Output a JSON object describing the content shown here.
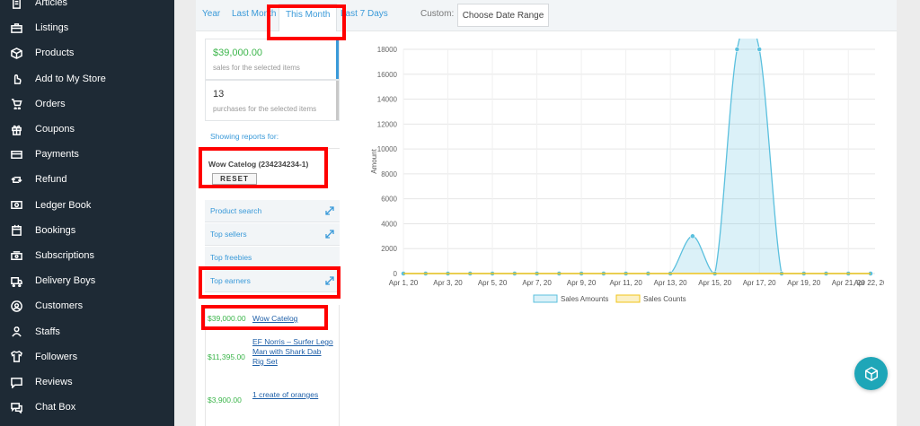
{
  "sidebar": {
    "items": [
      {
        "label": "Articles",
        "icon": "document-icon"
      },
      {
        "label": "Listings",
        "icon": "briefcase-icon"
      },
      {
        "label": "Products",
        "icon": "box-icon"
      },
      {
        "label": "Add to My Store",
        "icon": "hand-pointer-icon"
      },
      {
        "label": "Orders",
        "icon": "cart-icon"
      },
      {
        "label": "Coupons",
        "icon": "gift-icon"
      },
      {
        "label": "Payments",
        "icon": "credit-card-icon"
      },
      {
        "label": "Refund",
        "icon": "retweet-icon"
      },
      {
        "label": "Ledger Book",
        "icon": "money-icon"
      },
      {
        "label": "Bookings",
        "icon": "calendar-icon"
      },
      {
        "label": "Subscriptions",
        "icon": "cash-icon"
      },
      {
        "label": "Delivery Boys",
        "icon": "truck-icon"
      },
      {
        "label": "Customers",
        "icon": "user-circle-icon"
      },
      {
        "label": "Staffs",
        "icon": "user-icon"
      },
      {
        "label": "Followers",
        "icon": "shirt-icon"
      },
      {
        "label": "Reviews",
        "icon": "comment-icon"
      },
      {
        "label": "Chat Box",
        "icon": "chat-icon"
      }
    ]
  },
  "tabs": {
    "year": "Year",
    "last_month": "Last Month",
    "this_month": "This Month",
    "last_7_days": "Last 7 Days",
    "custom_label": "Custom:",
    "date_range_button": "Choose Date Range"
  },
  "stats": {
    "sales_value": "$39,000.00",
    "sales_desc": "sales for the selected items",
    "purchases_value": "13",
    "purchases_desc": "purchases for the selected items"
  },
  "filter": {
    "showing_label": "Showing reports for:",
    "catalog_name": "Wow Catelog (234234234-1)",
    "reset_label": "RESET"
  },
  "sections": {
    "product_search": "Product search",
    "top_sellers": "Top sellers",
    "top_freebies": "Top freebies",
    "top_earners": "Top earners"
  },
  "earners": [
    {
      "amount": "$39,000.00",
      "name": "Wow Catelog"
    },
    {
      "amount": "$11,395.00",
      "name": "EF Norris – Surfer Lego Man with Shark Dab Rig Set"
    },
    {
      "amount": "$3,900.00",
      "name": "1 create of oranges"
    }
  ],
  "colors": {
    "sidebar_bg": "#1e2a35",
    "accent": "#3a9ad9",
    "sales_series": "#5bc0de",
    "count_series": "#f0c419",
    "money_green": "#3bb54a",
    "highlight": "#ff0000",
    "fab": "#1ea6b8"
  },
  "chart_data": {
    "type": "area",
    "title": "",
    "xlabel": "",
    "ylabel": "Amount",
    "ylim": [
      0,
      18000
    ],
    "yticks": [
      0,
      2000,
      4000,
      6000,
      8000,
      10000,
      12000,
      14000,
      16000,
      18000
    ],
    "x": [
      "Apr 1, 20",
      "Apr 2, 20",
      "Apr 3, 20",
      "Apr 4, 20",
      "Apr 5, 20",
      "Apr 6, 20",
      "Apr 7, 20",
      "Apr 8, 20",
      "Apr 9, 20",
      "Apr 10, 20",
      "Apr 11, 20",
      "Apr 12, 20",
      "Apr 13, 20",
      "Apr 14, 20",
      "Apr 15, 20",
      "Apr 16, 20",
      "Apr 17, 20",
      "Apr 18, 20",
      "Apr 19, 20",
      "Apr 20, 20",
      "Apr 21, 20",
      "Apr 22, 20"
    ],
    "xtick_labels": [
      "Apr 1, 20",
      "Apr 3, 20",
      "Apr 5, 20",
      "Apr 7, 20",
      "Apr 9, 20",
      "Apr 11, 20",
      "Apr 13, 20",
      "Apr 15, 20",
      "Apr 17, 20",
      "Apr 19, 20",
      "Apr 21, 20",
      "Apr 22, 20"
    ],
    "series": [
      {
        "name": "Sales Amounts",
        "values": [
          0,
          0,
          0,
          0,
          0,
          0,
          0,
          0,
          0,
          0,
          0,
          0,
          0,
          3000,
          0,
          18000,
          18000,
          0,
          0,
          0,
          0,
          0
        ]
      },
      {
        "name": "Sales Counts",
        "values": [
          0,
          0,
          0,
          0,
          0,
          0,
          0,
          0,
          0,
          0,
          0,
          0,
          0,
          0,
          0,
          0,
          0,
          0,
          0,
          0,
          0,
          0
        ]
      }
    ],
    "grid": true,
    "legend": "bottom"
  }
}
